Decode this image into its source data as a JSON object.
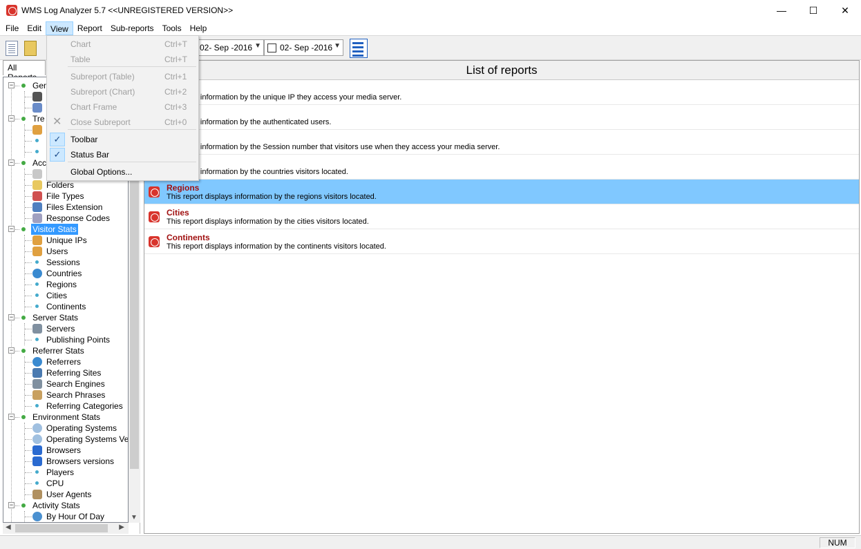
{
  "window": {
    "title": "WMS Log Analyzer 5.7 <<UNREGISTERED VERSION>>",
    "minimize": "—",
    "maximize": "☐",
    "close": "✕"
  },
  "menubar": {
    "items": [
      "File",
      "Edit",
      "View",
      "Report",
      "Sub-reports",
      "Tools",
      "Help"
    ],
    "active_index": 2
  },
  "toolbar": {
    "date_from": "02- Sep -2016",
    "date_to": "02- Sep -2016"
  },
  "left_panel": {
    "tab_label": "All Reports"
  },
  "tree": {
    "rows": [
      {
        "label": "Gen",
        "level": 0
      },
      {
        "label": "",
        "level": 1,
        "icon": "sigma-icon"
      },
      {
        "label": "",
        "level": 1,
        "icon": "table-icon"
      },
      {
        "label": "Tre",
        "level": 0
      },
      {
        "label": "",
        "level": 1,
        "icon": "user-icon"
      },
      {
        "label": "",
        "level": 1,
        "icon": "dot"
      },
      {
        "label": "",
        "level": 1,
        "icon": "dot"
      },
      {
        "label": "Acc",
        "level": 0
      },
      {
        "label": "",
        "level": 1,
        "icon": "doc-icon"
      },
      {
        "label": "Folders",
        "level": 1,
        "icon": "folder-icon"
      },
      {
        "label": "File Types",
        "level": 1,
        "icon": "filetypes-icon"
      },
      {
        "label": "Files Extension",
        "level": 1,
        "icon": "grid-icon"
      },
      {
        "label": "Response Codes",
        "level": 1,
        "icon": "speech-icon"
      },
      {
        "label": "Visitor Stats",
        "level": 0,
        "selected": true
      },
      {
        "label": "Unique IPs",
        "level": 1,
        "icon": "user-icon"
      },
      {
        "label": "Users",
        "level": 1,
        "icon": "user-icon"
      },
      {
        "label": "Sessions",
        "level": 1,
        "icon": "dot"
      },
      {
        "label": "Countries",
        "level": 1,
        "icon": "globe-icon"
      },
      {
        "label": "Regions",
        "level": 1,
        "icon": "dot"
      },
      {
        "label": "Cities",
        "level": 1,
        "icon": "dot"
      },
      {
        "label": "Continents",
        "level": 1,
        "icon": "dot"
      },
      {
        "label": "Server Stats",
        "level": 0
      },
      {
        "label": "Servers",
        "level": 1,
        "icon": "server-icon"
      },
      {
        "label": "Publishing Points",
        "level": 1,
        "icon": "dot"
      },
      {
        "label": "Referrer Stats",
        "level": 0
      },
      {
        "label": "Referrers",
        "level": 1,
        "icon": "globe-icon"
      },
      {
        "label": "Referring Sites",
        "level": 1,
        "icon": "monitor-icon"
      },
      {
        "label": "Search Engines",
        "level": 1,
        "icon": "server-icon"
      },
      {
        "label": "Search Phrases",
        "level": 1,
        "icon": "magnifier-icon"
      },
      {
        "label": "Referring Categories",
        "level": 1,
        "icon": "dot"
      },
      {
        "label": "Environment Stats",
        "level": 0
      },
      {
        "label": "Operating Systems",
        "level": 1,
        "icon": "disc-icon"
      },
      {
        "label": "Operating Systems Versio",
        "level": 1,
        "icon": "disc-icon"
      },
      {
        "label": "Browsers",
        "level": 1,
        "icon": "ie-icon"
      },
      {
        "label": "Browsers versions",
        "level": 1,
        "icon": "ie-icon"
      },
      {
        "label": "Players",
        "level": 1,
        "icon": "dot"
      },
      {
        "label": "CPU",
        "level": 1,
        "icon": "dot"
      },
      {
        "label": "User Agents",
        "level": 1,
        "icon": "image-icon"
      },
      {
        "label": "Activity Stats",
        "level": 0
      },
      {
        "label": "By Hour Of Day",
        "level": 1,
        "icon": "clock-icon"
      }
    ]
  },
  "right_panel": {
    "header": "List of reports",
    "reports": [
      {
        "title": "Ps",
        "desc": "t displays information by the unique IP they access your media server."
      },
      {
        "title": "",
        "desc": "t displays information by the authenticated users."
      },
      {
        "title": "",
        "desc": "t displays information by the Session number that visitors use when they access your media server."
      },
      {
        "title": "s",
        "desc": "t displays information by the countries visitors located."
      },
      {
        "title": "Regions",
        "desc": "This report displays information by the regions visitors located.",
        "selected": true
      },
      {
        "title": "Cities",
        "desc": "This report displays information by the cities visitors located."
      },
      {
        "title": "Continents",
        "desc": "This report displays information by the continents visitors located."
      }
    ]
  },
  "view_menu": {
    "items": [
      {
        "label": "Chart",
        "shortcut": "Ctrl+T",
        "disabled": true
      },
      {
        "label": "Table",
        "shortcut": "Ctrl+T",
        "disabled": true
      },
      {
        "label": "Subreport (Table)",
        "shortcut": "Ctrl+1",
        "disabled": true
      },
      {
        "label": "Subreport (Chart)",
        "shortcut": "Ctrl+2",
        "disabled": true
      },
      {
        "label": "Chart Frame",
        "shortcut": "Ctrl+3",
        "disabled": true
      },
      {
        "label": "Close Subreport",
        "shortcut": "Ctrl+0",
        "disabled": true
      },
      {
        "label": "Toolbar",
        "shortcut": "",
        "checked": true
      },
      {
        "label": "Status Bar",
        "shortcut": "",
        "checked": true
      },
      {
        "label": "Global Options...",
        "shortcut": ""
      }
    ]
  },
  "statusbar": {
    "num": "NUM"
  }
}
